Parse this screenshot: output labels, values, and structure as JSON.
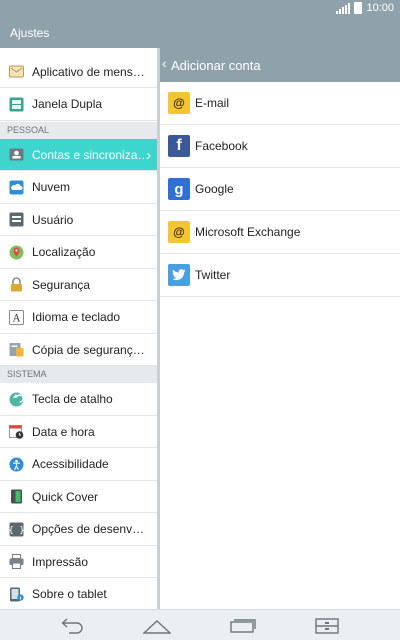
{
  "status": {
    "time": "10:00"
  },
  "appbar": {
    "title": "Ajustes"
  },
  "left": {
    "items_top": [
      {
        "label": "Aplicativo de mensagens",
        "icon": "messaging-app-icon"
      },
      {
        "label": "Janela Dupla",
        "icon": "dual-window-icon"
      }
    ],
    "section_pessoal": "PESSOAL",
    "items_pessoal": [
      {
        "label": "Contas e sincronização",
        "icon": "accounts-sync-icon"
      },
      {
        "label": "Nuvem",
        "icon": "cloud-icon"
      },
      {
        "label": "Usuário",
        "icon": "user-icon"
      },
      {
        "label": "Localização",
        "icon": "location-icon"
      },
      {
        "label": "Segurança",
        "icon": "lock-icon"
      },
      {
        "label": "Idioma e teclado",
        "icon": "language-keyboard-icon"
      },
      {
        "label": "Cópia de segurança e restauração",
        "icon": "backup-icon"
      }
    ],
    "section_sistema": "SISTEMA",
    "items_sistema": [
      {
        "label": "Tecla de atalho",
        "icon": "shortcut-key-icon"
      },
      {
        "label": "Data e hora",
        "icon": "calendar-clock-icon"
      },
      {
        "label": "Acessibilidade",
        "icon": "accessibility-icon"
      },
      {
        "label": "Quick Cover",
        "icon": "quick-cover-icon"
      },
      {
        "label": "Opções de desenvolvedor",
        "icon": "developer-options-icon"
      },
      {
        "label": "Impressão",
        "icon": "printer-icon"
      },
      {
        "label": "Sobre o tablet",
        "icon": "tablet-info-icon"
      }
    ]
  },
  "right": {
    "header_title": "Adicionar conta",
    "accounts": [
      {
        "label": "E-mail",
        "icon": "email-icon",
        "color": "#f2c531",
        "glyph": "@"
      },
      {
        "label": "Facebook",
        "icon": "facebook-icon",
        "color": "#3b5998",
        "glyph": "f"
      },
      {
        "label": "Google",
        "icon": "google-icon",
        "color": "#2f6fd6",
        "glyph": "g"
      },
      {
        "label": "Microsoft Exchange",
        "icon": "exchange-icon",
        "color": "#f2c531",
        "glyph": "@"
      },
      {
        "label": "Twitter",
        "icon": "twitter-icon",
        "color": "#4a9fe0",
        "glyph": "t"
      }
    ]
  },
  "nav": {
    "back_icon": "back-icon",
    "home_icon": "home-icon",
    "recents_icon": "recent-apps-icon",
    "menu_icon": "menu-icon"
  }
}
